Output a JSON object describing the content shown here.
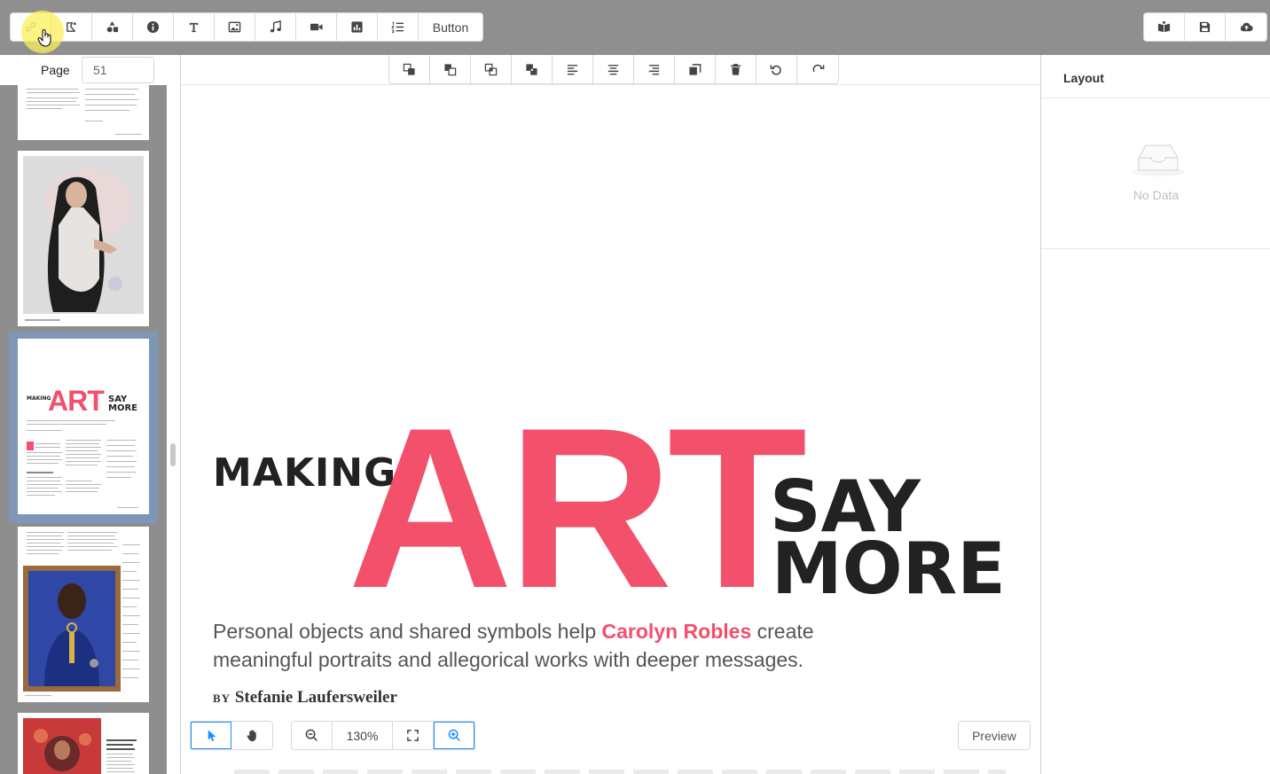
{
  "top_toolbar": {
    "tools": [
      {
        "name": "link",
        "icon": "link-icon"
      },
      {
        "name": "shape",
        "icon": "shape-edit-icon"
      },
      {
        "name": "shapes",
        "icon": "shapes-icon"
      },
      {
        "name": "info",
        "icon": "info-icon"
      },
      {
        "name": "text",
        "icon": "text-icon"
      },
      {
        "name": "image",
        "icon": "image-icon"
      },
      {
        "name": "audio",
        "icon": "music-icon"
      },
      {
        "name": "video",
        "icon": "video-icon"
      },
      {
        "name": "chart",
        "icon": "chart-icon"
      },
      {
        "name": "list",
        "icon": "list-icon"
      }
    ],
    "button_label": "Button",
    "right_tools": [
      {
        "name": "publish",
        "icon": "book-icon"
      },
      {
        "name": "save",
        "icon": "save-icon"
      },
      {
        "name": "upload",
        "icon": "cloud-upload-icon"
      }
    ]
  },
  "page_nav": {
    "label": "Page",
    "value": "51"
  },
  "canvas_toolbar": {
    "tools": [
      {
        "name": "bring-front",
        "icon": "bring-to-front-icon"
      },
      {
        "name": "send-back",
        "icon": "send-to-back-icon"
      },
      {
        "name": "bring-forward",
        "icon": "bring-forward-icon"
      },
      {
        "name": "send-backward",
        "icon": "send-backward-icon"
      },
      {
        "name": "align-left",
        "icon": "align-left-icon"
      },
      {
        "name": "align-center",
        "icon": "align-center-icon"
      },
      {
        "name": "align-right",
        "icon": "align-right-icon"
      },
      {
        "name": "copy",
        "icon": "copy-icon"
      },
      {
        "name": "delete",
        "icon": "trash-icon"
      },
      {
        "name": "undo",
        "icon": "undo-icon"
      },
      {
        "name": "redo",
        "icon": "redo-icon"
      }
    ]
  },
  "page": {
    "making": "MAKING",
    "art": "ART",
    "say": "SAY",
    "more": "MORE",
    "subtitle_pre": "Personal objects and shared symbols help ",
    "subtitle_highlight": "Carolyn Robles",
    "subtitle_post": " create meaningful portraits and allegorical works with deeper messages.",
    "byline_by": "BY",
    "byline_name": "Stefanie Laufersweiler"
  },
  "bottom_bar": {
    "zoom": "130%",
    "preview_label": "Preview"
  },
  "right_panel": {
    "title": "Layout",
    "empty_text": "No Data"
  },
  "colors": {
    "accent": "#f2506b",
    "selection": "#7f97b7",
    "primary": "#1890ff"
  }
}
